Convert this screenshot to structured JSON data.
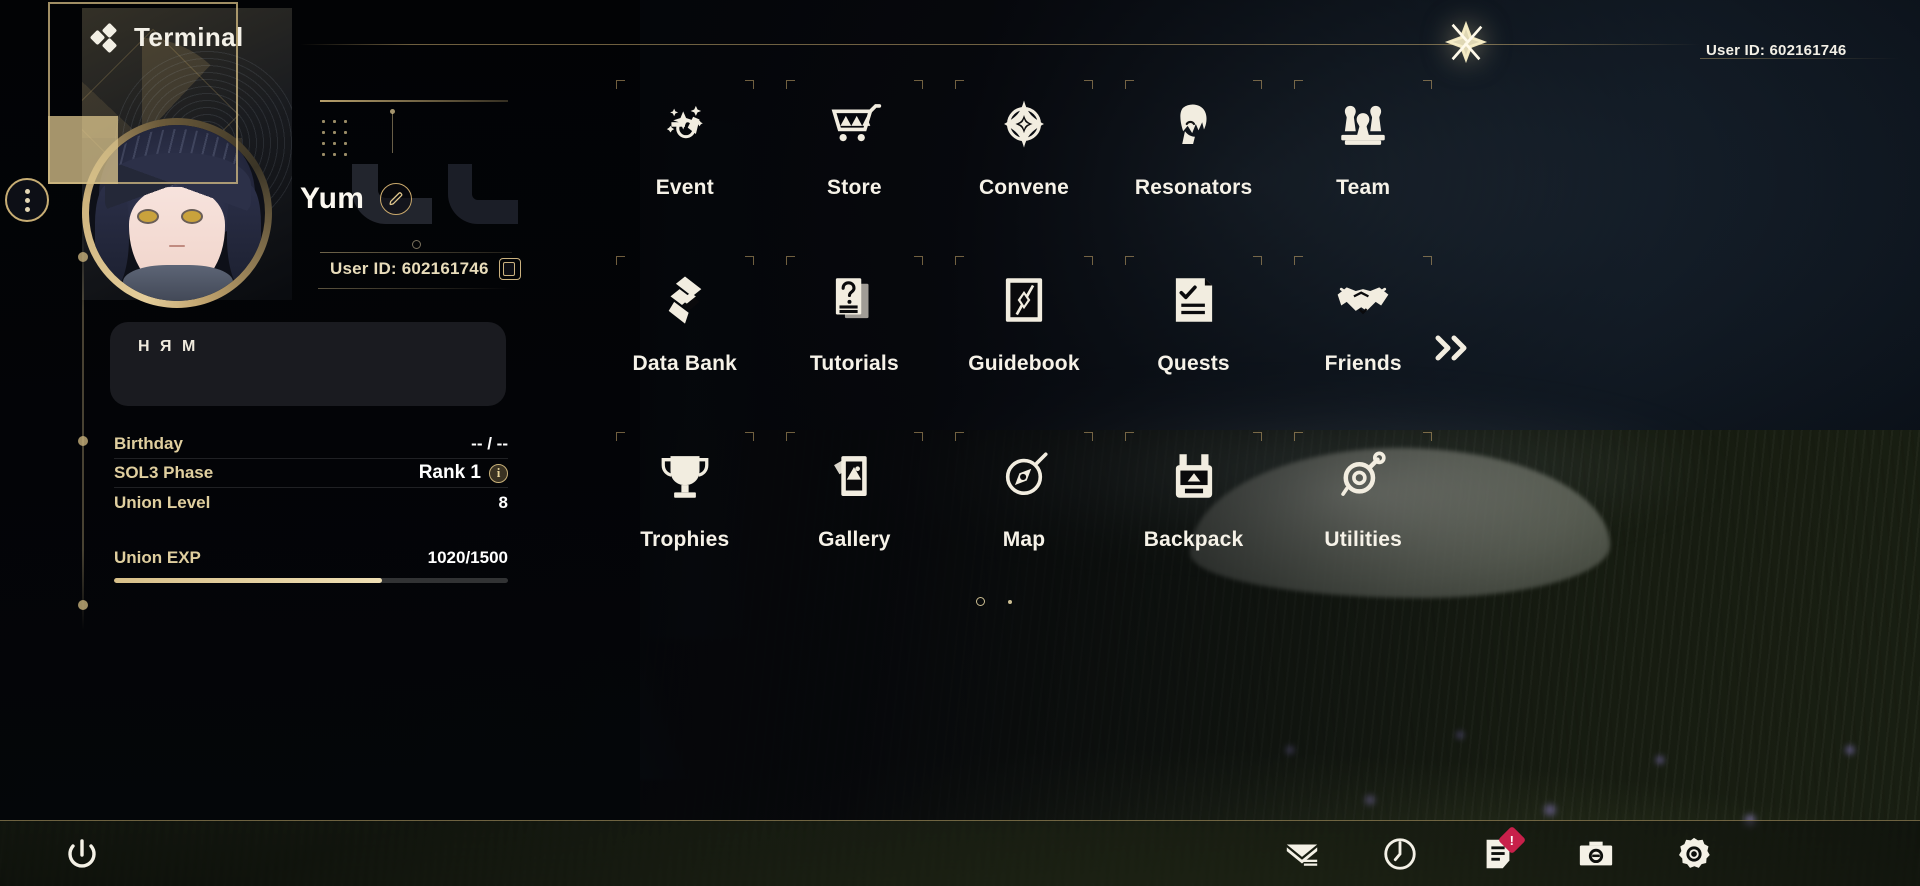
{
  "app": {
    "title": "Terminal",
    "close_label": "close"
  },
  "profile": {
    "player_name": "Yum",
    "user_id_label": "User ID: 602161746",
    "signature": "Н Я М",
    "edit_icon": "pencil-icon",
    "copy_icon": "copy-icon",
    "avatar_menu_icon": "more-options-icon",
    "stats": [
      {
        "label": "Birthday",
        "value": "-- / --",
        "info": false
      },
      {
        "label": "SOL3 Phase",
        "value": "Rank 1",
        "info": true,
        "info_glyph": "i"
      },
      {
        "label": "Union Level",
        "value": "8",
        "info": false
      }
    ],
    "exp": {
      "label": "Union EXP",
      "value": "1020/1500",
      "current": 1020,
      "max": 1500,
      "percent": 68
    }
  },
  "menu": {
    "items": [
      {
        "label": "Event",
        "icon": "event-sparkle-icon"
      },
      {
        "label": "Store",
        "icon": "shopping-cart-icon"
      },
      {
        "label": "Convene",
        "icon": "convene-star-icon"
      },
      {
        "label": "Resonators",
        "icon": "character-head-icon"
      },
      {
        "label": "Team",
        "icon": "chess-pieces-icon"
      },
      {
        "label": "Data Bank",
        "icon": "data-bank-icon"
      },
      {
        "label": "Tutorials",
        "icon": "question-card-icon"
      },
      {
        "label": "Guidebook",
        "icon": "guidebook-icon"
      },
      {
        "label": "Quests",
        "icon": "quest-checklist-icon"
      },
      {
        "label": "Friends",
        "icon": "handshake-icon"
      },
      {
        "label": "Trophies",
        "icon": "trophy-icon"
      },
      {
        "label": "Gallery",
        "icon": "photo-cards-icon"
      },
      {
        "label": "Map",
        "icon": "compass-icon"
      },
      {
        "label": "Backpack",
        "icon": "backpack-icon"
      },
      {
        "label": "Utilities",
        "icon": "utilities-gear-icon"
      }
    ],
    "next_page_icon": "double-chevron-right-icon"
  },
  "bottom_bar": {
    "power_icon": "power-icon",
    "tray": [
      {
        "icon": "mail-icon",
        "name": "mail",
        "badge": null
      },
      {
        "icon": "clock-icon",
        "name": "clock",
        "badge": null
      },
      {
        "icon": "notice-icon",
        "name": "notice",
        "badge": "!"
      },
      {
        "icon": "camera-icon",
        "name": "camera",
        "badge": null
      },
      {
        "icon": "settings-icon",
        "name": "settings",
        "badge": null
      }
    ],
    "user_id_label": "User ID: 602161746"
  },
  "colors": {
    "accent_gold": "#caa96c",
    "label_gold": "#e0cf9f",
    "text_light": "#f6f2e8",
    "badge_red": "#c8204a",
    "exp_fill": "#e2cb96"
  }
}
